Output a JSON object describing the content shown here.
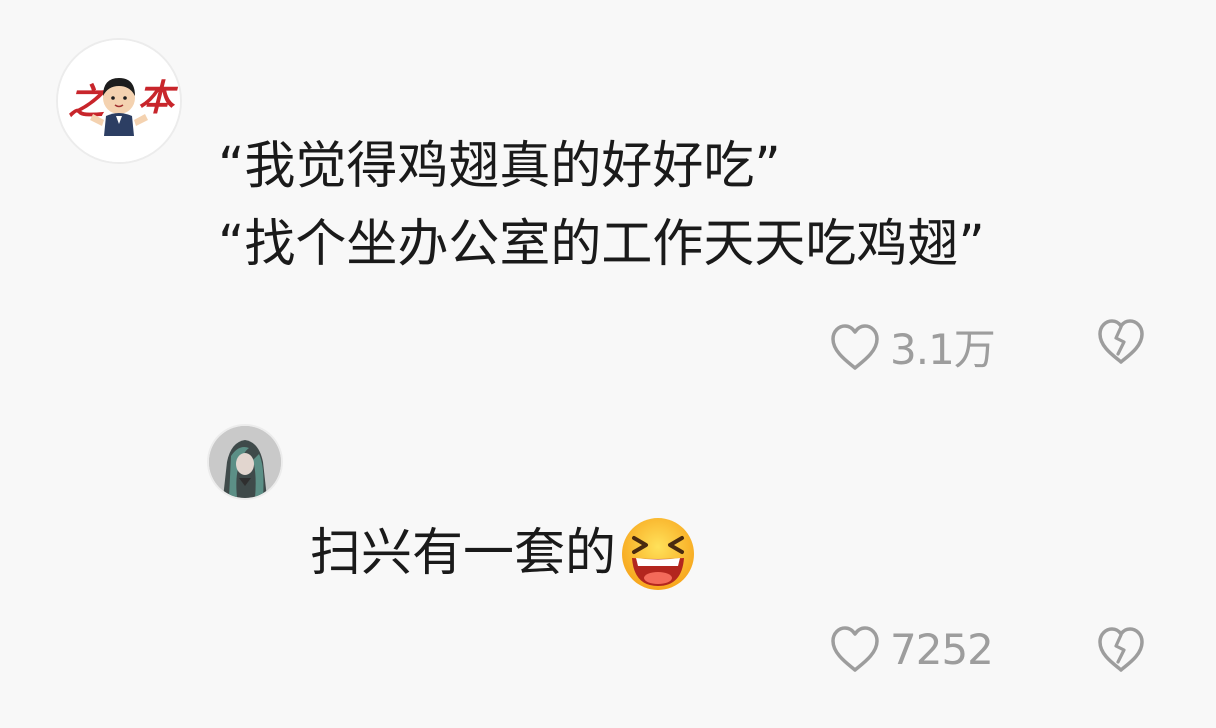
{
  "main_comment": {
    "lines": [
      "“我觉得鸡翅真的好好吃”",
      "“找个坐办公室的工作天天吃鸡翅”"
    ],
    "avatar_text_left": "之",
    "avatar_text_right": "本",
    "likes": "3.1万",
    "like_icon": "heart-outline-icon",
    "dislike_icon": "broken-heart-icon"
  },
  "reply_comment": {
    "text": "扫兴有一套的",
    "emoji": "laughing-squint-emoji",
    "likes": "7252",
    "like_icon": "heart-outline-icon",
    "dislike_icon": "broken-heart-icon"
  },
  "colors": {
    "background": "#f8f8f8",
    "text": "#1a1a1a",
    "meta": "#9d9d9d",
    "avatar_red": "#c8252b"
  }
}
